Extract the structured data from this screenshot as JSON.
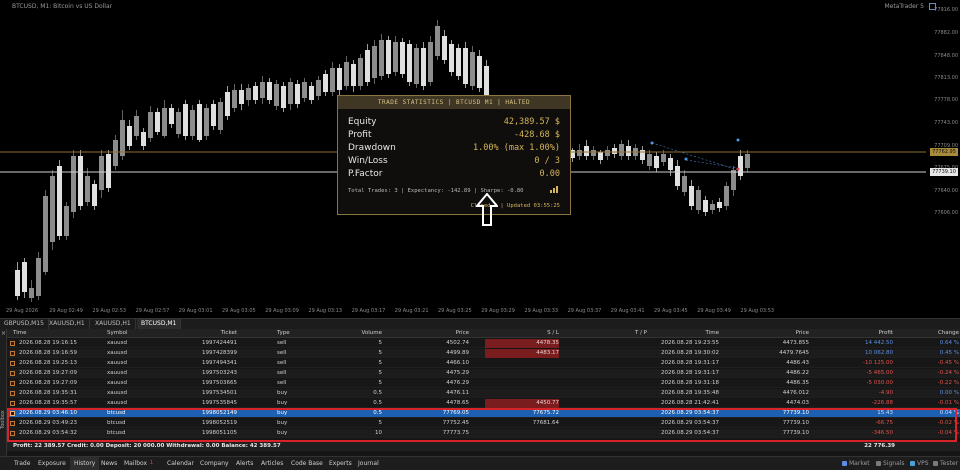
{
  "chart": {
    "title": "BTCUSD, M1: Bitcoin vs US Dollar",
    "top_right_label": "MetaTrader 5",
    "price_ticks": [
      "77916.00",
      "77882.00",
      "77848.00",
      "77813.00",
      "77778.00",
      "77743.00",
      "77709.00",
      "77675.00",
      "77640.00",
      "77606.00"
    ],
    "price_tag_gold": "77762.95",
    "price_tag_white": "77739.10",
    "time_ticks": [
      "29 Aug 2026",
      "29 Aug 02:49",
      "29 Aug 02:53",
      "29 Aug 02:57",
      "29 Aug 03:01",
      "29 Aug 03:05",
      "29 Aug 03:09",
      "29 Aug 03:13",
      "29 Aug 03:17",
      "29 Aug 03:21",
      "29 Aug 03:25",
      "29 Aug 03:29",
      "29 Aug 03:33",
      "29 Aug 03:37",
      "29 Aug 03:41",
      "29 Aug 03:45",
      "29 Aug 03:49",
      "29 Aug 03:53"
    ]
  },
  "stats": {
    "header": "TRADE STATISTICS | BTCUSD M1 | HALTED",
    "rows": [
      {
        "label": "Equity",
        "value": "42,389.57 $"
      },
      {
        "label": "Profit",
        "value": "-428.68 $"
      },
      {
        "label": "Drawdown",
        "value": "1.00% (max 1.00%)"
      },
      {
        "label": "Win/Loss",
        "value": "0 / 3"
      },
      {
        "label": "P.Factor",
        "value": "0.00"
      }
    ],
    "footer": "Total Trades: 3 | Expectancy: -142.89 | Sharpe: -0.80",
    "footer2": "Closed 3 | Updated 03:55:25"
  },
  "symbol_tabs": [
    "GBPUSD,M15",
    "XAUUSD,H1",
    "XAUUSD,H1",
    "BTCUSD,M1"
  ],
  "symbol_tab_active": 3,
  "table": {
    "headers": [
      "Time",
      "Symbol",
      "Ticket",
      "Type",
      "Volume",
      "Price",
      "S / L",
      "T / P",
      "Time",
      "Price",
      "Profit",
      "Change"
    ],
    "rows": [
      [
        "2026.08.28 19:16:15",
        "xauusd",
        "1997424491",
        "sell",
        "5",
        "4502.74",
        "4478.35",
        "",
        "2026.08.28 19:23:55",
        "4473.855",
        "14 442.50",
        "0.64 %"
      ],
      [
        "2026.08.28 19:16:59",
        "xauusd",
        "1997428399",
        "sell",
        "5",
        "4499.89",
        "4483.17",
        "",
        "2026.08.28 19:30:02",
        "4479.7645",
        "10 062.80",
        "0.45 %"
      ],
      [
        "2026.08.28 19:25:13",
        "xauusd",
        "1997494341",
        "sell",
        "5",
        "4466.10",
        "",
        "",
        "2026.08.28 19:31:17",
        "4486.43",
        "-10 125.00",
        "-0.45 %"
      ],
      [
        "2026.08.28 19:27:09",
        "xauusd",
        "1997503243",
        "sell",
        "5",
        "4475.29",
        "",
        "",
        "2026.08.28 19:31:17",
        "4486.22",
        "-5 465.00",
        "-0.24 %"
      ],
      [
        "2026.08.28 19:27:09",
        "xauusd",
        "1997503665",
        "sell",
        "5",
        "4476.29",
        "",
        "",
        "2026.08.28 19:31:18",
        "4486.35",
        "-5 030.00",
        "-0.22 %"
      ],
      [
        "2026.08.28 19:35:31",
        "xauusd",
        "1997534501",
        "buy",
        "0.5",
        "4476.11",
        "",
        "",
        "2026.08.28 19:35:48",
        "4476.012",
        "-4.90",
        "0.00 %"
      ],
      [
        "2026.08.28 19:35:57",
        "xauusd",
        "1997535845",
        "buy",
        "0.5",
        "4478.65",
        "4450.77",
        "",
        "2026.08.28 21:42:41",
        "4474.03",
        "-226.88",
        "-0.01 %"
      ],
      [
        "2026.08.29 03:46:10",
        "btcusd",
        "1998052149",
        "buy",
        "0.5",
        "77769.05",
        "77675.72",
        "",
        "2026.08.29 03:54:37",
        "77739.10",
        "15.43",
        "0.04 %"
      ],
      [
        "2026.08.29 03:49:23",
        "btcusd",
        "1998052519",
        "buy",
        "5",
        "77752.45",
        "77681.64",
        "",
        "2026.08.29 03:54:37",
        "77739.10",
        "-66.75",
        "-0.02 %"
      ],
      [
        "2026.08.29 03:54:32",
        "btcusd",
        "1998051105",
        "buy",
        "10",
        "77773.75",
        "",
        "",
        "2026.08.29 03:54:37",
        "77739.10",
        "-346.50",
        "-0.04 %"
      ]
    ],
    "summary_left": "Profit: 22 389.57  Credit: 0.00  Deposit: 20 000.00  Withdrawal: 0.00  Balance: 42 389.57",
    "summary_right": "22 776.39"
  },
  "bottom_tabs": [
    "Trade",
    "Exposure",
    "History",
    "News",
    "Mailbox",
    "Calendar",
    "Company",
    "Alerts",
    "Articles",
    "Code Base",
    "Experts",
    "Journal"
  ],
  "bottom_tab_active": 2,
  "mailbox_badge": "1",
  "bottom_right": [
    "Market",
    "Signals",
    "VPS",
    "Tester"
  ],
  "toolbox_label": "Toolbox"
}
